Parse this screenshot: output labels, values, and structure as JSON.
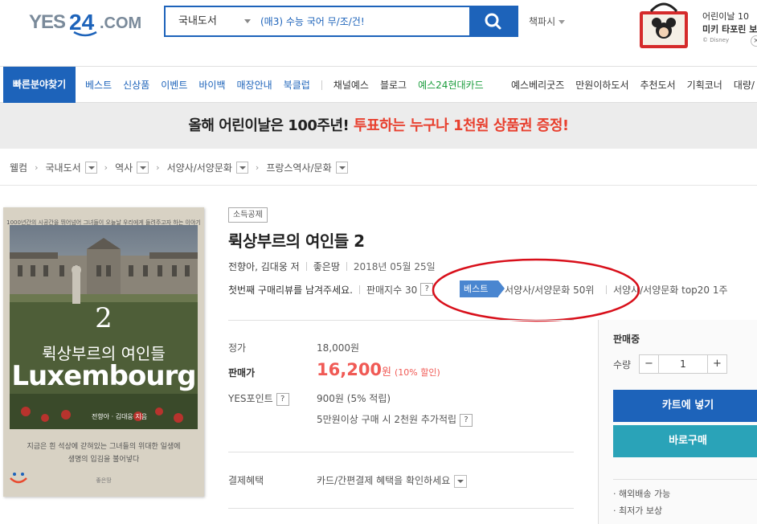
{
  "header": {
    "logo": "YES24.COM",
    "search_category": "국내도서",
    "search_placeholder": "(매3) 수능 국어 무/조/건!",
    "bookpass_label": "책파시",
    "promo_line1": "어린이날 10",
    "promo_line2": "미키 타포린 보",
    "promo_line3": "© Disney"
  },
  "nav": {
    "category_button": "빠른분야찾기",
    "items": [
      "베스트",
      "신상품",
      "이벤트",
      "바이백",
      "매장안내",
      "북클럽"
    ],
    "items2": [
      "채널예스",
      "블로그"
    ],
    "card_item": "예스24현대카드",
    "right_items": [
      "예스베리굿즈",
      "만원이하도서",
      "추천도서",
      "기획코너",
      "대량/"
    ]
  },
  "banner": {
    "text": "올해 어린이날은 100주년!",
    "highlight": "투표하는 누구나 1천원 상품권 증정!"
  },
  "breadcrumb": [
    "웰컴",
    "국내도서",
    "역사",
    "서양사/서양문화",
    "프랑스역사/문화"
  ],
  "cover": {
    "tagline": "1000년간의 시공간을 뛰어넘어 그녀들이 오늘날 우리에게 들려주고자 하는 이야기",
    "number": "2",
    "korean_title": "뤽상부르의 여인들",
    "latin_title": "Luxembourg",
    "authors": "전향아 · 김대웅 지음",
    "desc_line1": "지금은 흰 석상에 갇혀있는 그녀들의 위대한 일생에",
    "desc_line2": "생명의 입김을 불어넣다",
    "publisher": "좋은땅"
  },
  "book": {
    "badge": "소득공제",
    "title": "뤽상부르의 여인들 2",
    "author": "전향아, 김대웅 저",
    "publisher": "좋은땅",
    "date": "2018년 05월 25일",
    "review_prompt": "첫번째 구매리뷰를 남겨주세요.",
    "sales_index": "판매지수 30",
    "best_tag": "베스트",
    "rank1": "서양사/서양문화 50위",
    "rank2": "서양사/서양문화 top20 1주"
  },
  "pricing": {
    "list_label": "정가",
    "list_value": "18,000원",
    "sale_label": "판매가",
    "sale_value": "16,200",
    "sale_unit": "원",
    "discount": "(10% 할인)",
    "points_label": "YES포인트",
    "points_value": "900원 (5% 적립)",
    "points_extra": "5만원이상 구매 시 2천원 추가적립",
    "payment_label": "결제혜택",
    "payment_value": "카드/간편결제 혜택을 확인하세요"
  },
  "purchase": {
    "status": "판매중",
    "qty_label": "수량",
    "qty_value": "1",
    "minus": "−",
    "plus": "+",
    "cart_button": "카트에 넣기",
    "buy_button": "바로구매",
    "benefits": [
      "· 해외배송 가능",
      "· 최저가 보상"
    ]
  },
  "colors": {
    "brand_blue": "#1d63ba",
    "sale_red": "#f05a55",
    "buy_teal": "#2aa3b8",
    "annotation_red": "#d80f1a"
  }
}
